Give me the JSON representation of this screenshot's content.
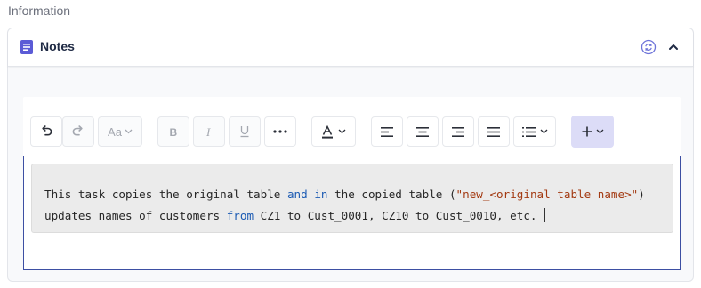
{
  "section": {
    "label": "Information"
  },
  "notes": {
    "title": "Notes",
    "icons": {
      "notes": "notes-doc-icon",
      "sync": "sync-icon",
      "collapse": "chevron-up-icon"
    }
  },
  "toolbar": {
    "font_label": "Aa",
    "buttons": [
      "undo",
      "redo",
      "font-size",
      "bold",
      "italic",
      "underline",
      "more",
      "text-color",
      "align-left",
      "align-center",
      "align-right",
      "justify",
      "list",
      "insert"
    ]
  },
  "editor": {
    "line1": {
      "t1": "This task copies the original table ",
      "k1": "and",
      "t2": " ",
      "k2": "in",
      "t3": " the copied table (",
      "s1": "\"new_<original table name>\"",
      "t4": ")"
    },
    "line2": {
      "t1": "updates names of customers ",
      "k1": "from",
      "t2": " CZ1 to Cust_0001, CZ10 to Cust_0010, etc."
    }
  },
  "colors": {
    "accent": "#5b5bd6",
    "keyword": "#1c5bb3",
    "string": "#a33a12",
    "editor_border": "#3d4fa3",
    "insert_bg": "#dcdcf7"
  }
}
